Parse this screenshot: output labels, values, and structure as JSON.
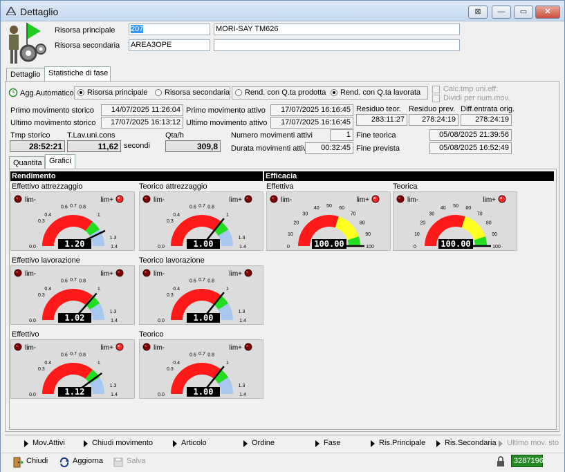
{
  "window": {
    "title": "Dettaglio",
    "btn_restore": "⊠",
    "btn_min": "—",
    "btn_max": "▭",
    "btn_close": "✕"
  },
  "header": {
    "risorsa_principale_label": "Risorsa principale",
    "risorsa_principale_code": "207",
    "risorsa_principale_desc": "MORI-SAY TM626",
    "risorsa_secondaria_label": "Risorsa secondaria",
    "risorsa_secondaria_code": "AREA3OPE",
    "risorsa_secondaria_desc": ""
  },
  "tabs": [
    {
      "label": "Dettaglio"
    },
    {
      "label": "Statistiche di fase"
    }
  ],
  "options": {
    "agg_automatico": "Agg.Automatico",
    "radio1": [
      {
        "label": "Risorsa principale",
        "checked": true
      },
      {
        "label": "Risorsa secondaria",
        "checked": false
      }
    ],
    "radio2": [
      {
        "label": "Rend. con Q.ta prodotta",
        "checked": false
      },
      {
        "label": "Rend. con Q.ta lavorata",
        "checked": true
      }
    ],
    "check1": "Calc.tmp uni.eff.",
    "check2": "Dividi per num.mov."
  },
  "stats": {
    "primo_storico_label": "Primo movimento storico",
    "primo_storico": "14/07/2025 11:26:04",
    "ultimo_storico_label": "Ultimo movimento storico",
    "ultimo_storico": "17/07/2025 16:13:12",
    "primo_attivo_label": "Primo movimento attivo",
    "primo_attivo": "17/07/2025 16:16:45",
    "ultimo_attivo_label": "Ultimo movimento attivo",
    "ultimo_attivo": "17/07/2025 16:16:45",
    "residuo_teor_label": "Residuo teor.",
    "residuo_teor": "283:11:27",
    "residuo_prev_label": "Residuo prev.",
    "residuo_prev": "278:24:19",
    "diff_label": "Diff.entrata orig.",
    "diff": "278:24:19",
    "tmp_storico_label": "Tmp storico",
    "tmp_storico": "28:52:21",
    "tlav_label": "T.Lav.uni.cons",
    "tlav": "11,62",
    "secondi": "secondi",
    "qtah_label": "Qta/h",
    "qtah": "309,8",
    "num_mov_label": "Numero movimenti attivi",
    "num_mov": "1",
    "durata_label": "Durata movimenti attivi",
    "durata": "00:32:45",
    "fine_teorica_label": "Fine teorica",
    "fine_teorica": "05/08/2025 21:39:56",
    "fine_prevista_label": "Fine prevista",
    "fine_prevista": "05/08/2025 16:52:49"
  },
  "subtabs": [
    {
      "label": "Quantita"
    },
    {
      "label": "Grafici"
    }
  ],
  "sections": {
    "rendimento": "Rendimento",
    "efficacia": "Efficacia"
  },
  "gauges_small": [
    {
      "title": "Effettivo attrezzaggio",
      "value": 1.2,
      "display": "1.20",
      "lim_plus_on": true
    },
    {
      "title": "Teorico attrezzaggio",
      "value": 1.0,
      "display": "1.00",
      "lim_plus_on": false
    },
    {
      "title": "Effettivo lavorazione",
      "value": 1.02,
      "display": "1.02",
      "lim_plus_on": false
    },
    {
      "title": "Teorico lavorazione",
      "value": 1.0,
      "display": "1.00",
      "lim_plus_on": false
    },
    {
      "title": "Effettivo",
      "value": 1.12,
      "display": "1.12",
      "lim_plus_on": true
    },
    {
      "title": "Teorico",
      "value": 1.0,
      "display": "1.00",
      "lim_plus_on": false
    }
  ],
  "gauges_big": [
    {
      "title": "Effettiva",
      "value": 100,
      "display": "100.00",
      "lim_plus_on": true
    },
    {
      "title": "Teorica",
      "value": 100,
      "display": "100.00",
      "lim_plus_on": true
    }
  ],
  "small_ticks": [
    "0.0",
    "0.3",
    "0.4",
    "0.6",
    "0.7",
    "0.8",
    "1",
    "1.3",
    "1.4"
  ],
  "big_ticks": [
    "0",
    "10",
    "20",
    "30",
    "40",
    "50",
    "60",
    "70",
    "80",
    "90",
    "100"
  ],
  "lim_minus": "lim-",
  "lim_plus": "lim+",
  "bottom_buttons": [
    {
      "label": "Mov.Attivi",
      "enabled": true
    },
    {
      "label": "Chiudi movimento",
      "enabled": true
    },
    {
      "label": "Articolo",
      "enabled": true
    },
    {
      "label": "Ordine",
      "enabled": true
    },
    {
      "label": "Fase",
      "enabled": true
    },
    {
      "label": "Ris.Principale",
      "enabled": true
    },
    {
      "label": "Ris.Secondaria",
      "enabled": true
    },
    {
      "label": "Ultimo mov. sto",
      "enabled": false
    }
  ],
  "status_bar": {
    "chiudi": "Chiudi",
    "aggiorna": "Aggiorna",
    "salva": "Salva",
    "counter": "3287196"
  },
  "colors": {
    "red": "#ff1a1a",
    "green": "#22dd22",
    "yellow": "#ffff22",
    "blue": "#a8c8f0",
    "gauge_bg": "#dcdcdc"
  }
}
